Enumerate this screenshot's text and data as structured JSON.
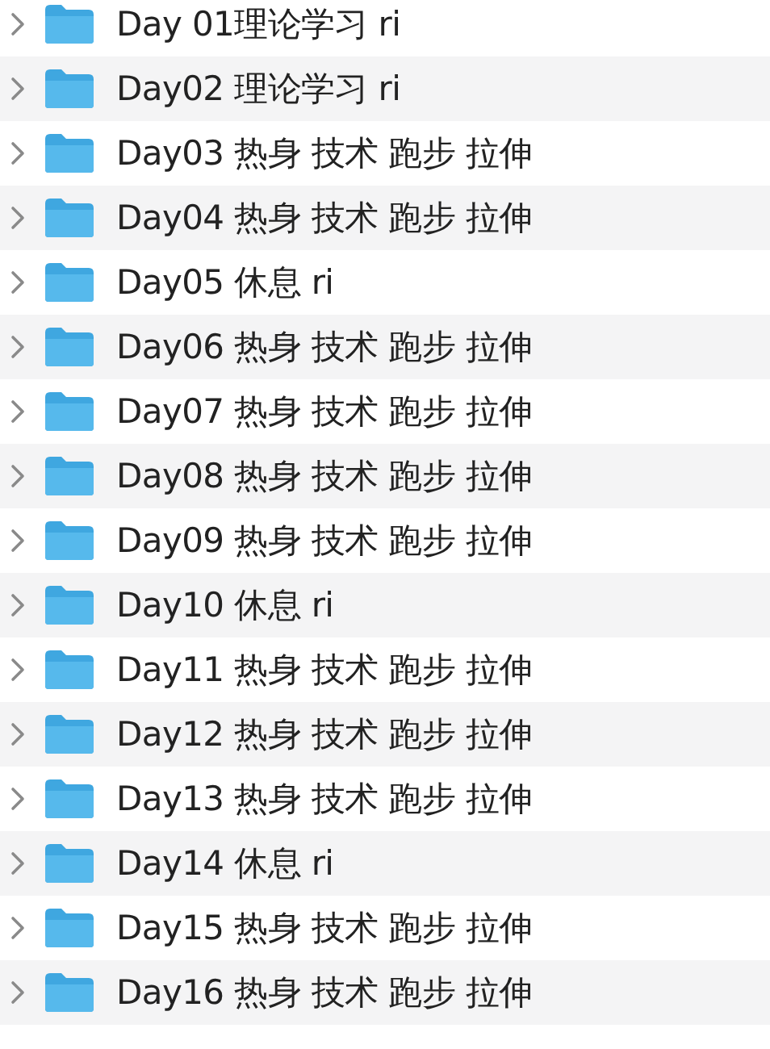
{
  "files": [
    {
      "name": "Day 01理论学习 ri",
      "expanded": false
    },
    {
      "name": "Day02 理论学习 ri",
      "expanded": false
    },
    {
      "name": "Day03 热身 技术 跑步 拉伸",
      "expanded": false
    },
    {
      "name": "Day04 热身 技术 跑步 拉伸",
      "expanded": false
    },
    {
      "name": "Day05 休息 ri",
      "expanded": false
    },
    {
      "name": "Day06 热身 技术 跑步 拉伸",
      "expanded": false
    },
    {
      "name": "Day07 热身 技术 跑步 拉伸",
      "expanded": false
    },
    {
      "name": "Day08 热身 技术 跑步 拉伸",
      "expanded": false
    },
    {
      "name": "Day09 热身 技术 跑步 拉伸",
      "expanded": false
    },
    {
      "name": "Day10 休息 ri",
      "expanded": false
    },
    {
      "name": "Day11 热身 技术 跑步 拉伸",
      "expanded": false
    },
    {
      "name": "Day12 热身 技术 跑步 拉伸",
      "expanded": false
    },
    {
      "name": "Day13 热身 技术 跑步 拉伸",
      "expanded": false
    },
    {
      "name": "Day14 休息 ri",
      "expanded": false
    },
    {
      "name": "Day15 热身 技术 跑步 拉伸",
      "expanded": false
    },
    {
      "name": "Day16 热身 技术 跑步 拉伸",
      "expanded": false
    }
  ]
}
